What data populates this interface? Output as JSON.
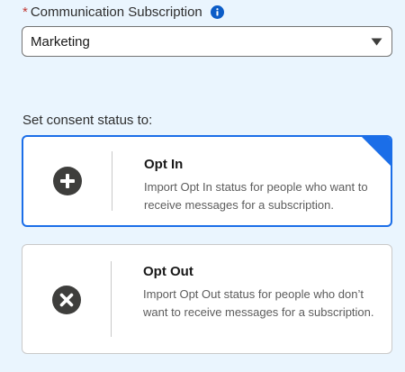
{
  "subscription_field": {
    "required_marker": "*",
    "label": "Communication Subscription",
    "info_icon": "info-icon",
    "selected_value": "Marketing"
  },
  "consent": {
    "label": "Set consent status to:",
    "options": [
      {
        "title": "Opt In",
        "description": "Import Opt In status for people who want to receive messages for a subscription.",
        "icon": "plus-circle-icon",
        "selected": true
      },
      {
        "title": "Opt Out",
        "description": "Import Opt Out status for people who don’t want to receive messages for a subscription.",
        "icon": "close-circle-icon",
        "selected": false
      }
    ]
  },
  "colors": {
    "background": "#eaf5fe",
    "accent": "#1b6ee8",
    "required": "#c23934",
    "icon_fill": "#3e3e3c"
  }
}
